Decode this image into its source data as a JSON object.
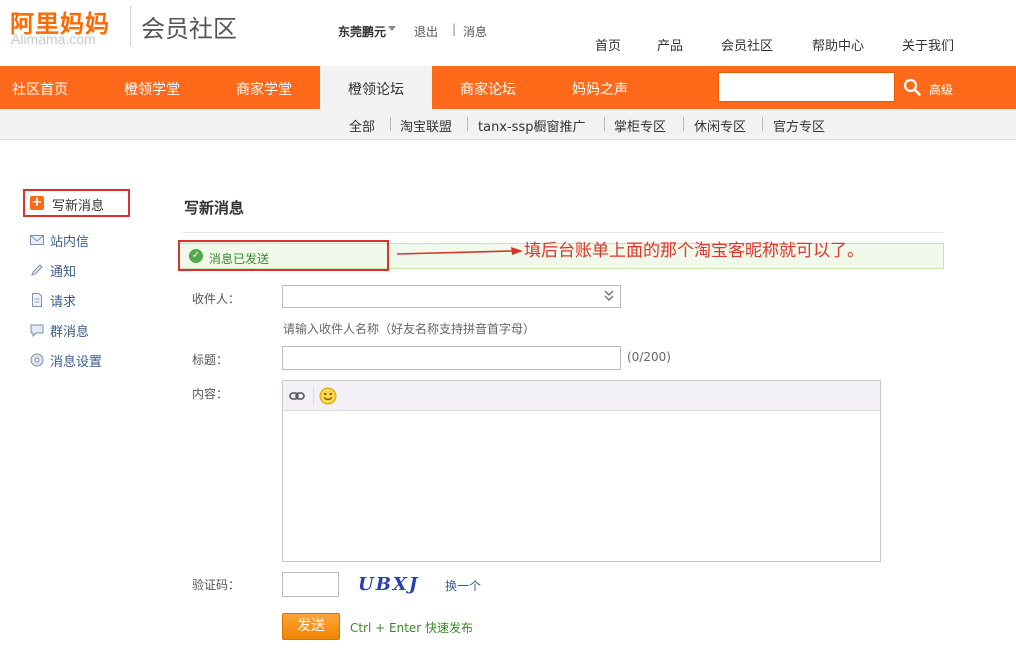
{
  "brand": {
    "logo_cn": "阿里妈妈",
    "logo_en": "Alimama.com",
    "subtitle": "会员社区"
  },
  "user_bar": {
    "username": "东莞鹏元",
    "logout": "退出",
    "separator": "|",
    "messages": "消息"
  },
  "top_nav": [
    "首页",
    "产品",
    "会员社区",
    "帮助中心",
    "关于我们"
  ],
  "main_tabs": [
    {
      "label": "社区首页",
      "active": false
    },
    {
      "label": "橙领学堂",
      "active": false
    },
    {
      "label": "商家学堂",
      "active": false
    },
    {
      "label": "橙领论坛",
      "active": true
    },
    {
      "label": "商家论坛",
      "active": false
    },
    {
      "label": "妈妈之声",
      "active": false
    }
  ],
  "search": {
    "placeholder": "",
    "advanced_label": "高级"
  },
  "sub_nav": [
    "全部",
    "淘宝联盟",
    "tanx-ssp橱窗推广",
    "掌柜专区",
    "休闲专区",
    "官方专区"
  ],
  "sidebar": {
    "compose": "写新消息",
    "items": [
      {
        "label": "站内信",
        "icon": "envelope-icon"
      },
      {
        "label": "通知",
        "icon": "pencil-icon"
      },
      {
        "label": "请求",
        "icon": "document-icon"
      },
      {
        "label": "群消息",
        "icon": "chat-bubble-icon"
      },
      {
        "label": "消息设置",
        "icon": "settings-circle-icon"
      }
    ]
  },
  "main": {
    "title": "写新消息",
    "notice": "消息已发送",
    "annotation": "填后台账单上面的那个淘宝客昵称就可以了。",
    "recipient_label": "收件人：",
    "recipient_value": "",
    "recipient_hint": "请输入收件人名称（好友名称支持拼音首字母）",
    "subject_label": "标题：",
    "subject_value": "",
    "subject_count": "(0/200)",
    "content_label": "内容：",
    "captcha_label": "验证码：",
    "captcha_value": "",
    "captcha_text": "UBXJ",
    "captcha_refresh": "换一个",
    "send_button": "发送",
    "shortcut_hint": "Ctrl + Enter 快速发布"
  },
  "colors": {
    "brand_orange": "#ff6a1a",
    "annotation_red": "#d8342c",
    "success_green": "#3a8a2c",
    "link_blue": "#3a5e8c"
  }
}
